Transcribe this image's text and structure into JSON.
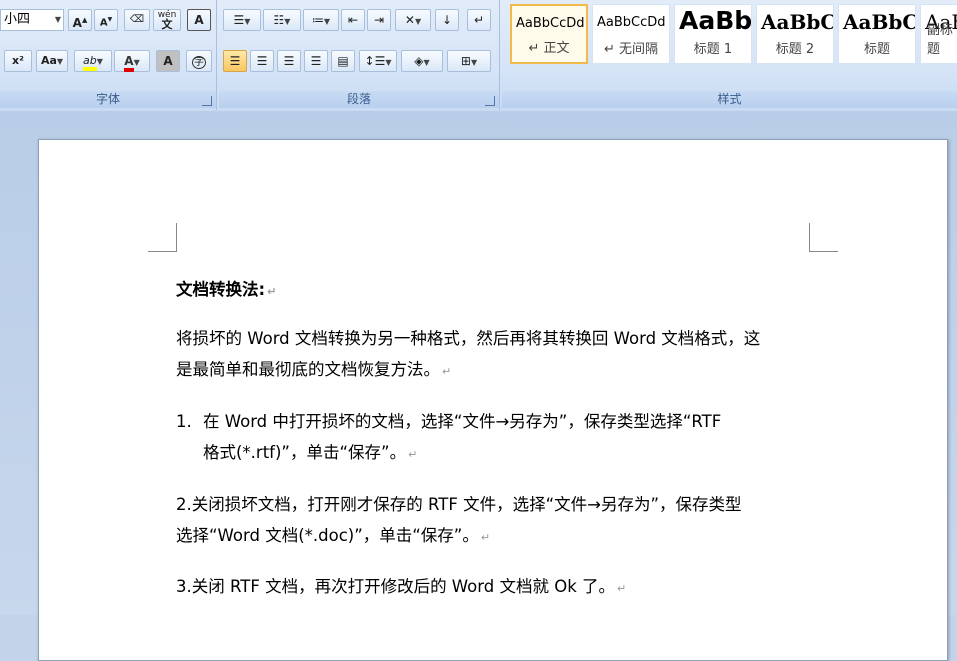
{
  "ribbon": {
    "font_group": {
      "title": "字体",
      "font_size": "小四",
      "buttons": {
        "grow_font": "A",
        "shrink_font": "A",
        "clear_format": "Aa",
        "phonetic": "wén",
        "char_border": "A",
        "superscript": "x²",
        "change_case": "Aa",
        "highlight": "ab",
        "font_color": "A",
        "char_shading": "A",
        "enclose_char": "字"
      }
    },
    "paragraph_group": {
      "title": "段落"
    },
    "styles_group": {
      "title": "样式",
      "styles": [
        {
          "preview": "AaBbCcDd",
          "name": "↵ 正文"
        },
        {
          "preview": "AaBbCcDd",
          "name": "↵ 无间隔"
        },
        {
          "preview": "AaBb",
          "name": "标题 1"
        },
        {
          "preview": "AaBbC",
          "name": "标题 2"
        },
        {
          "preview": "AaBbC",
          "name": "标题"
        },
        {
          "preview": "AaBbC",
          "name": "副标题"
        }
      ]
    }
  },
  "document": {
    "heading": "文档转换法:",
    "intro_line1": "将损坏的 Word 文档转换为另一种格式，然后再将其转换回 Word 文档格式，这",
    "intro_line2": "是最简单和最彻底的文档恢复方法。",
    "step1_num": "1.",
    "step1_line1": "在 Word 中打开损坏的文档，选择“文件→另存为”，保存类型选择“RTF",
    "step1_line2": "格式(*.rtf)”，单击“保存”。",
    "step2_line1": "2.关闭损坏文档，打开刚才保存的 RTF 文件，选择“文件→另存为”，保存类型",
    "step2_line2": "选择“Word 文档(*.doc)”，单击“保存”。",
    "step3_line1": "3.关闭 RTF 文档，再次打开修改后的 Word 文档就 Ok 了。",
    "para_mark": "↵"
  }
}
